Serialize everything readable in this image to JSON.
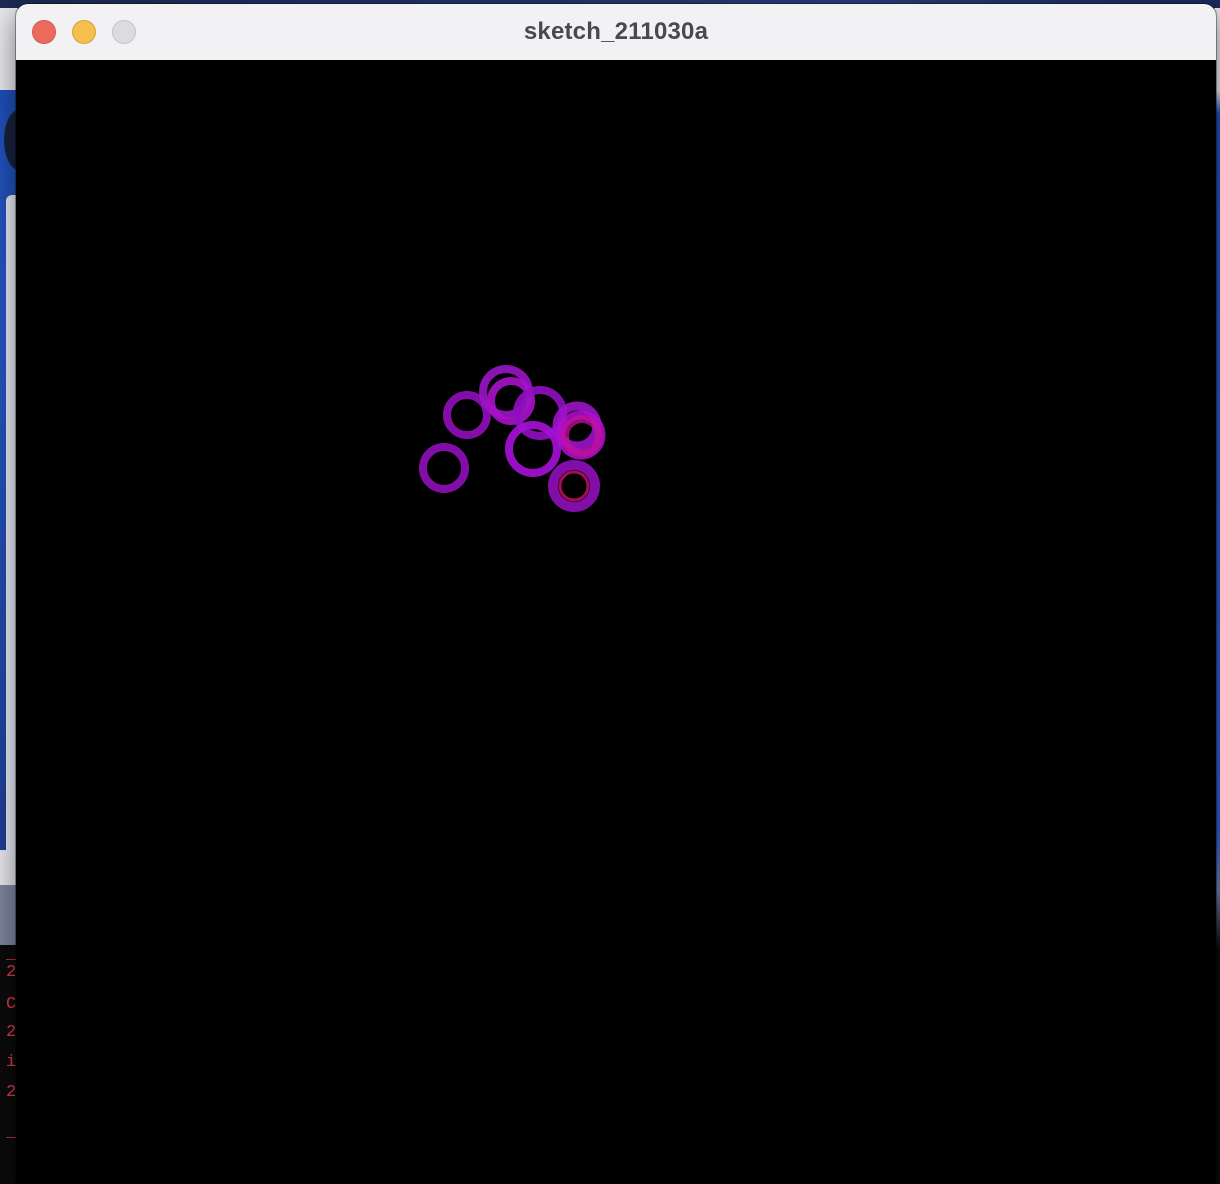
{
  "window": {
    "title": "sketch_211030a",
    "controls": {
      "close_icon": "close-icon",
      "minimize_icon": "minimize-icon",
      "zoom_icon": "zoom-icon"
    }
  },
  "canvas": {
    "background": "#000000",
    "ring_colors": {
      "violet": "#8a0fb0",
      "purple": "#9b14c8",
      "magenta": "#b10fd0",
      "pink_magenta": "#c0119e",
      "hot_center": "#d1106a"
    }
  },
  "background_console": {
    "lines": [
      "_",
      "2",
      "C",
      "2",
      "i",
      "2",
      "_"
    ]
  }
}
